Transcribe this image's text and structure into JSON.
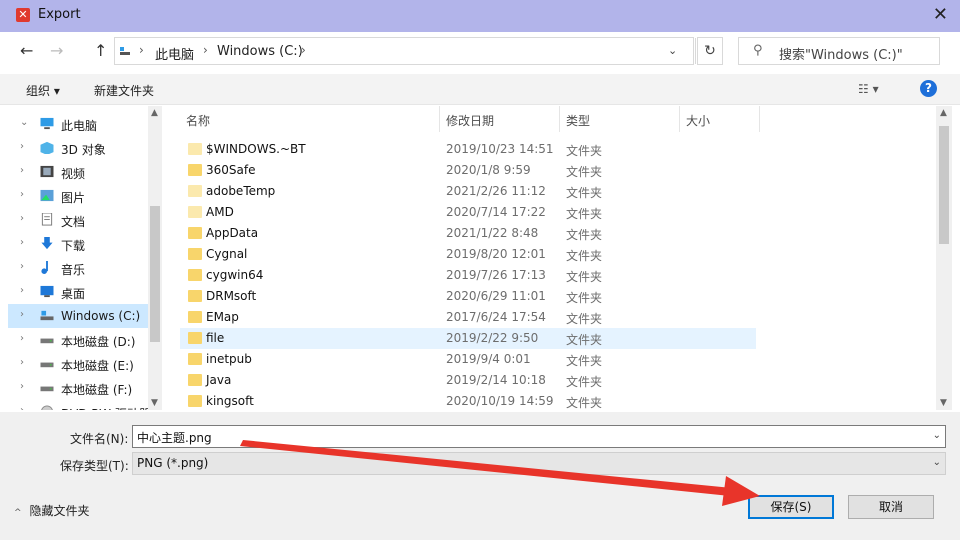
{
  "window": {
    "title": "Export",
    "close_glyph": "✕"
  },
  "nav": {
    "back": "←",
    "forward": "→",
    "up": "↑"
  },
  "address": {
    "crumbs": [
      "此电脑",
      "Windows (C:)"
    ],
    "chevron": "›",
    "dropdown": "⌄"
  },
  "refresh_glyph": "↻",
  "search": {
    "placeholder": "搜索\"Windows (C:)\"",
    "icon": "search-icon"
  },
  "toolbar": {
    "organize": "组织 ▾",
    "new_folder": "新建文件夹",
    "view_glyph": "☷ ▾",
    "help": "?"
  },
  "tree": [
    {
      "label": "此电脑",
      "icon": "pc-icon",
      "arrow": "⌄"
    },
    {
      "label": "3D 对象",
      "icon": "cube-icon",
      "arrow": "›"
    },
    {
      "label": "视频",
      "icon": "video-icon",
      "arrow": "›"
    },
    {
      "label": "图片",
      "icon": "picture-icon",
      "arrow": "›"
    },
    {
      "label": "文档",
      "icon": "document-icon",
      "arrow": "›"
    },
    {
      "label": "下载",
      "icon": "download-icon",
      "arrow": "›"
    },
    {
      "label": "音乐",
      "icon": "music-icon",
      "arrow": "›"
    },
    {
      "label": "桌面",
      "icon": "desktop-icon",
      "arrow": "›"
    },
    {
      "label": "Windows (C:)",
      "icon": "drive-c-icon",
      "arrow": "›",
      "selected": true
    },
    {
      "label": "本地磁盘 (D:)",
      "icon": "drive-icon",
      "arrow": "›"
    },
    {
      "label": "本地磁盘 (E:)",
      "icon": "drive-icon",
      "arrow": "›"
    },
    {
      "label": "本地磁盘 (F:)",
      "icon": "drive-icon",
      "arrow": "›"
    },
    {
      "label": "DVD RW 驱动器",
      "icon": "dvd-icon",
      "arrow": "›"
    }
  ],
  "columns": {
    "name": "名称",
    "date": "修改日期",
    "type": "类型",
    "size": "大小",
    "sort_caret": "^"
  },
  "files": [
    {
      "name": "$WINDOWS.~BT",
      "date": "2019/10/23 14:51",
      "type": "文件夹",
      "pale": true
    },
    {
      "name": "360Safe",
      "date": "2020/1/8 9:59",
      "type": "文件夹"
    },
    {
      "name": "adobeTemp",
      "date": "2021/2/26 11:12",
      "type": "文件夹",
      "pale": true
    },
    {
      "name": "AMD",
      "date": "2020/7/14 17:22",
      "type": "文件夹",
      "pale": true
    },
    {
      "name": "AppData",
      "date": "2021/1/22 8:48",
      "type": "文件夹"
    },
    {
      "name": "Cygnal",
      "date": "2019/8/20 12:01",
      "type": "文件夹"
    },
    {
      "name": "cygwin64",
      "date": "2019/7/26 17:13",
      "type": "文件夹"
    },
    {
      "name": "DRMsoft",
      "date": "2020/6/29 11:01",
      "type": "文件夹"
    },
    {
      "name": "EMap",
      "date": "2017/6/24 17:54",
      "type": "文件夹"
    },
    {
      "name": "file",
      "date": "2019/2/22 9:50",
      "type": "文件夹",
      "selected": true
    },
    {
      "name": "inetpub",
      "date": "2019/9/4 0:01",
      "type": "文件夹"
    },
    {
      "name": "Java",
      "date": "2019/2/14 10:18",
      "type": "文件夹"
    },
    {
      "name": "kingsoft",
      "date": "2020/10/19 14:59",
      "type": "文件夹"
    }
  ],
  "form": {
    "filename_label": "文件名(N):",
    "filename_value": "中心主题.png",
    "filetype_label": "保存类型(T):",
    "filetype_value": "PNG (*.png)",
    "dropdown": "⌄"
  },
  "hide_folders": {
    "caret": "^",
    "label": "隐藏文件夹"
  },
  "buttons": {
    "save": "保存(S)",
    "cancel": "取消"
  },
  "scroll": {
    "up": "▲",
    "down": "▼"
  },
  "colors": {
    "titlebar": "#b2b4ea",
    "selection": "#cce8ff",
    "folder": "#f8d56b",
    "annotation_arrow": "#e8342a",
    "accent": "#0078d7"
  }
}
